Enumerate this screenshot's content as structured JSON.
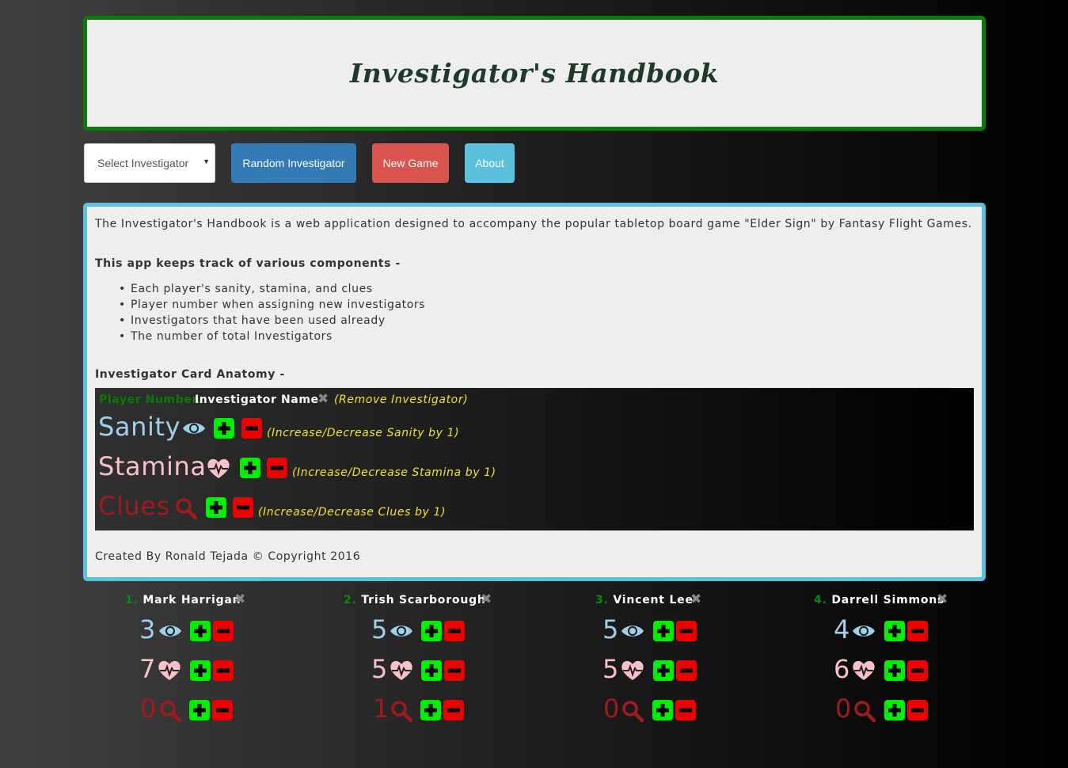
{
  "header": {
    "title": "Investigator's Handbook"
  },
  "toolbar": {
    "select_label": "Select Investigator",
    "random_label": "Random Investigator",
    "new_game_label": "New Game",
    "about_label": "About"
  },
  "about": {
    "intro": "The Investigator's Handbook is a web application designed to accompany the popular tabletop board game \"Elder Sign\" by Fantasy Flight Games.",
    "keeps_title": "This app keeps track of various components -",
    "items": [
      "Each player's sanity, stamina, and clues",
      "Player number when assigning new investigators",
      "Investigators that have been used already",
      "The number of total Investigators"
    ],
    "anatomy_title": "Investigator Card Anatomy -",
    "anatomy": {
      "player_number": "Player Number.",
      "investigator_name": "Investigator Name",
      "remove_note": "(Remove Investigator)",
      "sanity_label": "Sanity",
      "sanity_note": "(Increase/Decrease Sanity by 1)",
      "stamina_label": "Stamina",
      "stamina_note": "(Increase/Decrease Stamina by 1)",
      "clues_label": "Clues",
      "clues_note": "(Increase/Decrease Clues by 1)"
    },
    "footer": "Created By Ronald Tejada © Copyright 2016"
  },
  "players": [
    {
      "number": "1.",
      "name": "Mark Harrigan",
      "sanity": "3",
      "stamina": "7",
      "clues": "0"
    },
    {
      "number": "2.",
      "name": "Trish Scarborough",
      "sanity": "5",
      "stamina": "5",
      "clues": "1"
    },
    {
      "number": "3.",
      "name": "Vincent Lee",
      "sanity": "5",
      "stamina": "5",
      "clues": "0"
    },
    {
      "number": "4.",
      "name": "Darrell Simmons",
      "sanity": "4",
      "stamina": "6",
      "clues": "0"
    }
  ],
  "colors": {
    "header_border": "#0a7a0a",
    "about_border": "#5bc0de",
    "random_button": "#337ab7",
    "new_game_button": "#d9534f",
    "about_button": "#5bc0de",
    "sanity": "#9ed0ec",
    "stamina": "#f8c0c8",
    "clues": "#a01c1c",
    "plus": "#00ee00",
    "minus": "#ee0000",
    "note": "#f4e232"
  },
  "icons": [
    "eye-icon",
    "heartbeat-icon",
    "search-icon",
    "plus-icon",
    "minus-icon",
    "close-icon",
    "dropdown-arrow-icon"
  ]
}
